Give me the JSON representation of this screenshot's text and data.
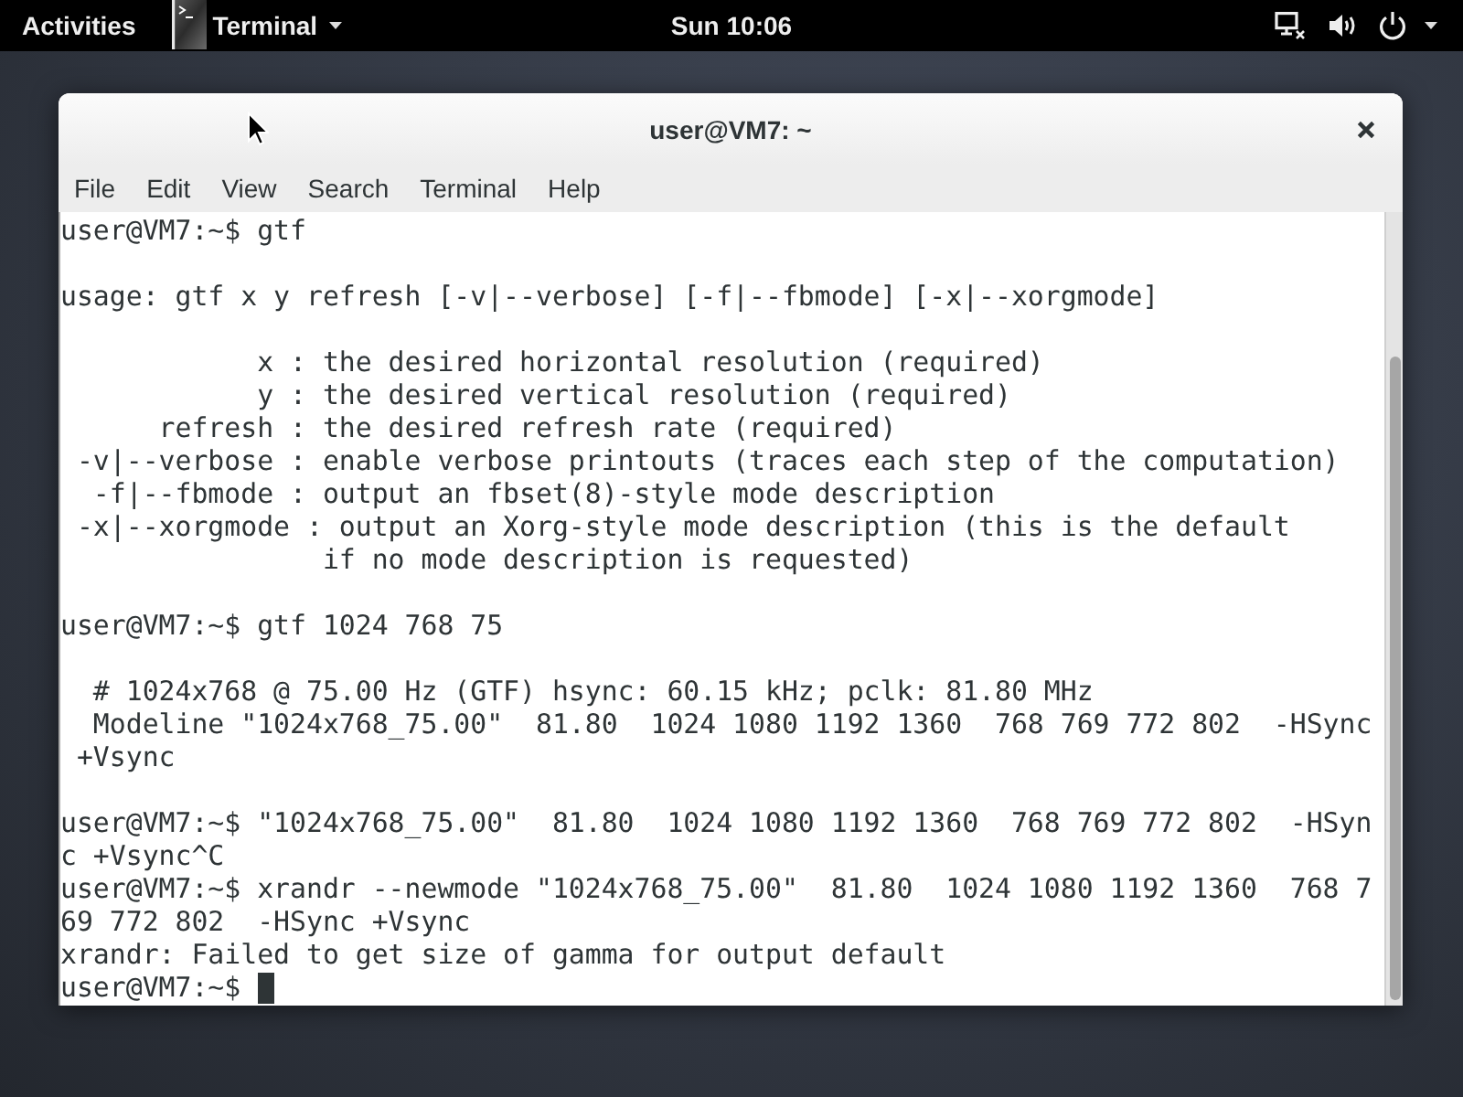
{
  "top_bar": {
    "activities": "Activities",
    "app_menu": {
      "label": "Terminal"
    },
    "clock": "Sun 10:06"
  },
  "window": {
    "title": "user@VM7: ~",
    "menu": [
      "File",
      "Edit",
      "View",
      "Search",
      "Terminal",
      "Help"
    ]
  },
  "terminal": {
    "blocks": [
      {
        "lines": [
          "user@VM7:~$ gtf"
        ]
      },
      {
        "lines": [
          "usage: gtf x y refresh [-v|--verbose] [-f|--fbmode] [-x|--xorgmode]"
        ]
      },
      {
        "lines": [
          "            x : the desired horizontal resolution (required)",
          "            y : the desired vertical resolution (required)",
          "      refresh : the desired refresh rate (required)",
          " -v|--verbose : enable verbose printouts (traces each step of the computation)",
          "  -f|--fbmode : output an fbset(8)-style mode description",
          " -x|--xorgmode : output an Xorg-style mode description (this is the default",
          "                if no mode description is requested)"
        ]
      },
      {
        "lines": [
          "user@VM7:~$ gtf 1024 768 75"
        ]
      },
      {
        "lines": [
          "  # 1024x768 @ 75.00 Hz (GTF) hsync: 60.15 kHz; pclk: 81.80 MHz",
          "  Modeline \"1024x768_75.00\"  81.80  1024 1080 1192 1360  768 769 772 802  -HSync",
          " +Vsync"
        ]
      },
      {
        "lines": [
          "user@VM7:~$ \"1024x768_75.00\"  81.80  1024 1080 1192 1360  768 769 772 802  -HSyn",
          "c +Vsync^C",
          "user@VM7:~$ xrandr --newmode \"1024x768_75.00\"  81.80  1024 1080 1192 1360  768 7",
          "69 772 802  -HSync +Vsync",
          "xrandr: Failed to get size of gamma for output default",
          "user@VM7:~$"
        ]
      }
    ],
    "cursor": true
  }
}
